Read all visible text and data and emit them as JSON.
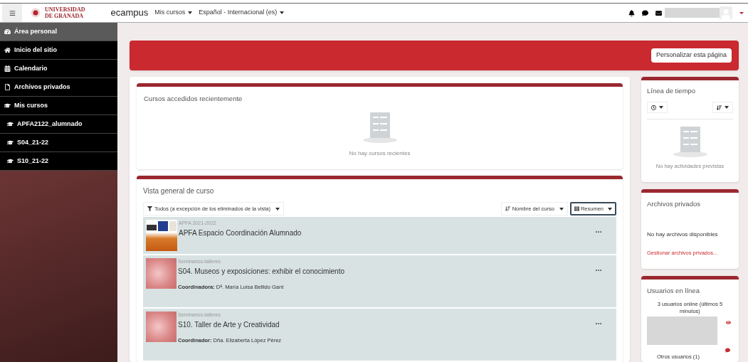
{
  "navbar": {
    "logo_lines": [
      "UNIVERSIDAD",
      "DE GRANADA"
    ],
    "brand": "ecampus",
    "menus": [
      "Mis cursos",
      "Español - Internacional (es)"
    ]
  },
  "sidebar": {
    "items": [
      {
        "label": "Área personal",
        "kind": "dashboard",
        "selected": true,
        "indented": false
      },
      {
        "label": "Inicio del sitio",
        "kind": "home",
        "selected": false,
        "indented": false
      },
      {
        "label": "Calendario",
        "kind": "calendar",
        "selected": false,
        "indented": false
      },
      {
        "label": "Archivos privados",
        "kind": "file",
        "selected": false,
        "indented": false
      },
      {
        "label": "Mis cursos",
        "kind": "course",
        "selected": false,
        "indented": false
      },
      {
        "label": "APFA2122_alumnado",
        "kind": "course",
        "selected": false,
        "indented": true
      },
      {
        "label": "S04_21-22",
        "kind": "course",
        "selected": false,
        "indented": true
      },
      {
        "label": "S10_21-22",
        "kind": "course",
        "selected": false,
        "indented": true
      }
    ]
  },
  "header": {
    "button": "Personalizar esta página"
  },
  "recent": {
    "title": "Cursos accedidos recientemente",
    "empty": "No hay cursos recientes"
  },
  "overview": {
    "title": "Vista general de curso",
    "filter": "Todos (a excepción de los eliminados de la vista)",
    "sort": "Nombre del curso",
    "view": "Resumen",
    "courses": [
      {
        "kind": "logo",
        "category": "APFA 2021-2022",
        "name": "APFA Espacio Coordinación Alumnado",
        "menu": "…"
      },
      {
        "kind": "pattern",
        "category": "Seminarios-talleres",
        "name": "S04. Museos y exposiciones: exhibir el conocimiento",
        "role": "Coordinadora:",
        "person": "Dª. María Luisa Bellido Gant",
        "menu": "…"
      },
      {
        "kind": "pattern",
        "category": "Seminarios-talleres",
        "name": "S10. Taller de Arte y Creatividad",
        "role": "Coordinador:",
        "person": "Dña. Elizaberta López Pérez",
        "menu": "…"
      }
    ]
  },
  "timeline": {
    "title": "Línea de tiempo",
    "empty": "No hay actividades previstas"
  },
  "files": {
    "title": "Archivos privados",
    "empty": "No hay archivos disponibles",
    "link": "Gestionar archivos privados..."
  },
  "online": {
    "title": "Usuarios en línea",
    "summary": "3 usuarios online (últimos 5 minutos)",
    "others": "Otros usuarios (1)"
  }
}
